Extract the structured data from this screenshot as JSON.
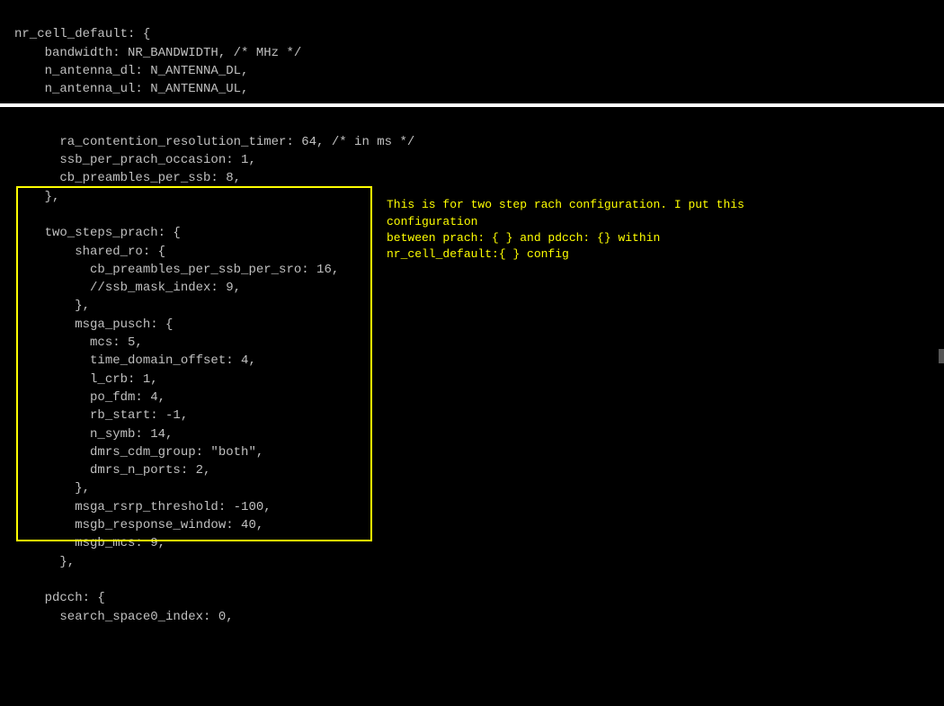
{
  "top": {
    "line1": "nr_cell_default: {",
    "line2": "    bandwidth: NR_BANDWIDTH, /* MHz */",
    "line3": "    n_antenna_dl: N_ANTENNA_DL,",
    "line4": "    n_antenna_ul: N_ANTENNA_UL,"
  },
  "main": {
    "l1": "      ra_contention_resolution_timer: 64, /* in ms */",
    "l2": "      ssb_per_prach_occasion: 1,",
    "l3": "      cb_preambles_per_ssb: 8,",
    "l4": "    },",
    "l5": "",
    "l6": "    two_steps_prach: {",
    "l7": "        shared_ro: {",
    "l8": "          cb_preambles_per_ssb_per_sro: 16,",
    "l9": "          //ssb_mask_index: 9,",
    "l10": "        },",
    "l11": "        msga_pusch: {",
    "l12": "          mcs: 5,",
    "l13": "          time_domain_offset: 4,",
    "l14": "          l_crb: 1,",
    "l15": "          po_fdm: 4,",
    "l16": "          rb_start: -1,",
    "l17": "          n_symb: 14,",
    "l18": "          dmrs_cdm_group: \"both\",",
    "l19": "          dmrs_n_ports: 2,",
    "l20": "        },",
    "l21": "        msga_rsrp_threshold: -100,",
    "l22": "        msgb_response_window: 40,",
    "l23": "        msgb_mcs: 9,",
    "l24": "      },",
    "l25": "",
    "l26": "    pdcch: {",
    "l27": "      search_space0_index: 0,"
  },
  "annotation": {
    "line1": "This is for two step rach configuration. I put this configuration",
    "line2": "between prach: { } and pdcch: {} within nr_cell_default:{ } config"
  }
}
